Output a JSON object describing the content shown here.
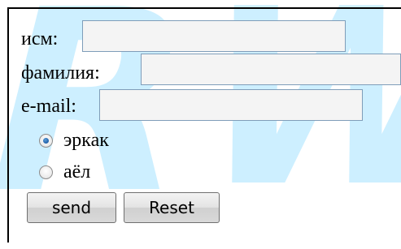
{
  "form": {
    "first_name_label": "исм:",
    "first_name_value": "",
    "last_name_label": "фамилия:",
    "last_name_value": "",
    "email_label": "e-mail:",
    "email_value": "",
    "gender_options": [
      {
        "label": "эркак",
        "checked": true
      },
      {
        "label": "аёл",
        "checked": false
      }
    ],
    "send_label": "send",
    "reset_label": "Reset"
  },
  "watermark": {
    "text": "RW",
    "color": "#cdefff"
  }
}
